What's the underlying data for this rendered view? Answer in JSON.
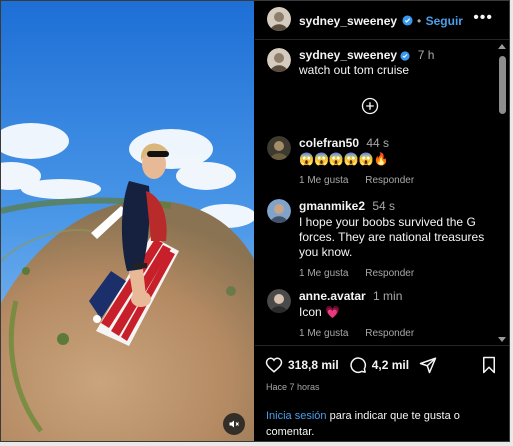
{
  "header": {
    "username": "sydney_sweeney",
    "separator": "•",
    "follow_label": "Seguir",
    "more_label": "•••"
  },
  "caption": {
    "username": "sydney_sweeney",
    "time": "7 h",
    "text": "watch out tom cruise"
  },
  "comments": [
    {
      "username": "colefran50",
      "time": "44 s",
      "text": "😱😱😱😱😱🔥",
      "likes_label": "1 Me gusta",
      "reply_label": "Responder"
    },
    {
      "username": "gmanmike2",
      "time": "54 s",
      "text": "I hope your boobs survived the G forces. They are national treasures you know.",
      "likes_label": "1 Me gusta",
      "reply_label": "Responder"
    },
    {
      "username": "anne.avatar",
      "time": "1 min",
      "text": "Icon 💗",
      "likes_label": "1 Me gusta",
      "reply_label": "Responder"
    }
  ],
  "footer": {
    "likes_count": "318,8 mil",
    "comments_count": "4,2 mil",
    "time_ago": "Hace 7 horas",
    "login_link": "Inicia sesión",
    "login_text": " para indicar que te gusta o comentar."
  },
  "icons": {
    "verified": "verified-badge-icon",
    "add": "add-circle-icon",
    "like": "heart-icon",
    "comment": "comment-bubble-icon",
    "share": "send-icon",
    "save": "bookmark-icon",
    "mute": "speaker-muted-icon"
  },
  "colors": {
    "background": "#000000",
    "text": "#f5f5f5",
    "muted": "#a8a8a8",
    "link": "#4a9eea",
    "verified": "#3897f0"
  }
}
